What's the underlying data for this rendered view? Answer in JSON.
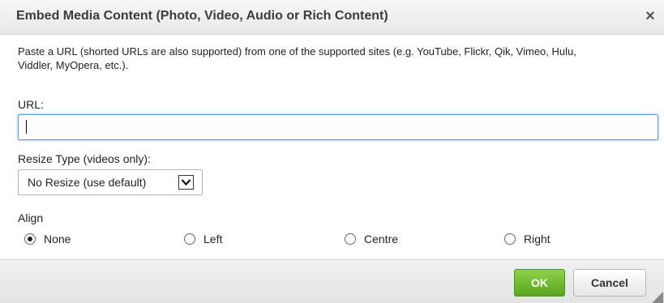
{
  "dialog": {
    "title": "Embed Media Content (Photo, Video, Audio or Rich Content)",
    "close_icon": "×"
  },
  "description": "Paste a URL (shorted URLs are also supported) from one of the supported sites (e.g. YouTube, Flickr, Qik, Vimeo, Hulu, Viddler, MyOpera, etc.).",
  "url": {
    "label": "URL:",
    "value": "",
    "placeholder": ""
  },
  "resize": {
    "label": "Resize Type (videos only):",
    "selected": "No Resize (use default)"
  },
  "align": {
    "label": "Align",
    "options": [
      "None",
      "Left",
      "Centre",
      "Right"
    ],
    "selected": "None"
  },
  "buttons": {
    "ok": "OK",
    "cancel": "Cancel"
  },
  "colors": {
    "ok_button": "#6dbb2e",
    "input_focus": "#5d9be0"
  },
  "icons": {
    "close": "close-icon",
    "dropdown": "chevron-down-icon",
    "resize": "resize-grip-icon"
  }
}
